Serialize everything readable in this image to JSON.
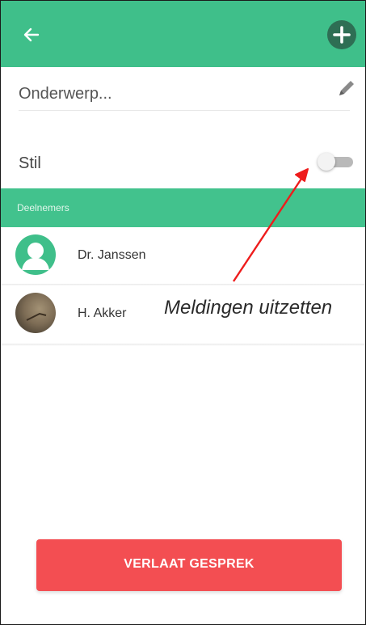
{
  "appbar": {
    "back_icon": "arrow-left-icon",
    "add_icon": "plus-icon",
    "color": "#3fbf8a"
  },
  "subject": {
    "placeholder": "Onderwerp...",
    "edit_icon": "pencil-icon"
  },
  "silent": {
    "label": "Stil",
    "enabled": false
  },
  "participants": {
    "header": "Deelnemers",
    "items": [
      {
        "name": "Dr. Janssen",
        "avatar": "generic-user-avatar"
      },
      {
        "name": "H. Akker",
        "avatar": "photo-avatar"
      }
    ]
  },
  "annotation": {
    "text": "Meldingen uitzetten",
    "arrow_color": "#ee1c1c"
  },
  "actions": {
    "leave_label": "VERLAAT GESPREK",
    "leave_color": "#f34e52"
  }
}
